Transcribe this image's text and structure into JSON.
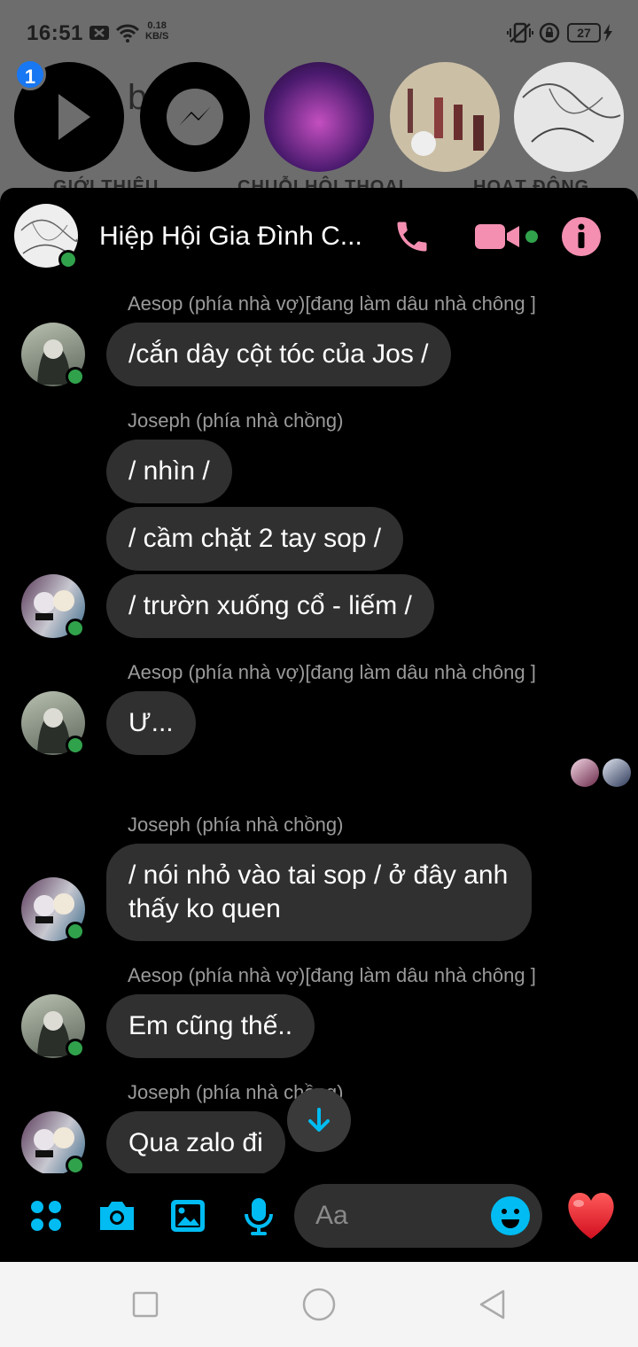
{
  "status_bar": {
    "time": "16:51",
    "net_speed_value": "0.18",
    "net_speed_unit": "KB/S",
    "battery": "27"
  },
  "tray": {
    "badge_count": "1",
    "background_name_fragment": "b",
    "labels": [
      "GIỚI THIỆU",
      "CHUỖI HỘI THOẠI",
      "HOẠT ĐỘNG"
    ]
  },
  "header": {
    "title": "Hiệp Hội Gia Đình C..."
  },
  "messages": [
    {
      "sender": "Aesop (phía nhà vợ)[đang làm dâu nhà chông ]",
      "texts": [
        "/cắn dây cột tóc của Jos /"
      ]
    },
    {
      "sender": "Joseph (phía nhà chồng)",
      "texts": [
        "/ nhìn /",
        "/ cầm chặt 2 tay sop /",
        "/ trườn xuống cổ - liếm /"
      ]
    },
    {
      "sender": "Aesop (phía nhà vợ)[đang làm dâu nhà chông ]",
      "texts": [
        "Ư..."
      ]
    },
    {
      "sender": "Joseph (phía nhà chồng)",
      "texts": [
        "/ nói nhỏ vào tai sop / ở đây anh thấy ko quen"
      ]
    },
    {
      "sender": "Aesop (phía nhà vợ)[đang làm dâu nhà chông ]",
      "texts": [
        "Em cũng thế.."
      ]
    },
    {
      "sender": "Joseph (phía nhà chồng)",
      "texts": [
        "Qua zalo đi"
      ]
    }
  ],
  "composer": {
    "placeholder": "Aa"
  },
  "colors": {
    "accent_pink": "#f48fb1",
    "accent_cyan": "#00bcf2",
    "online_green": "#31a24c",
    "bubble_gray": "#303030"
  },
  "icons": [
    "menu-dots-icon",
    "camera-icon",
    "gallery-icon",
    "microphone-icon",
    "emoji-icon",
    "heart-icon",
    "phone-icon",
    "video-icon",
    "info-icon",
    "arrow-down-icon"
  ]
}
